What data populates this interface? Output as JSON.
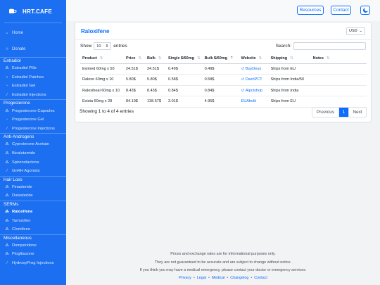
{
  "brand": {
    "title": "HRT.CAFE"
  },
  "sidebar": {
    "top": [
      {
        "label": "Home",
        "icon": "home-icon"
      },
      {
        "label": "Donate",
        "icon": "donate-icon"
      }
    ],
    "sections": [
      {
        "title": "Estradiol",
        "items": [
          "Estradiol Pills",
          "Estradiol Patches",
          "Estradiol Gel",
          "Estradiol Injections"
        ]
      },
      {
        "title": "Progesterone",
        "items": [
          "Progesterone Capsules",
          "Progesterone Gel",
          "Progesterone Injections"
        ]
      },
      {
        "title": "Anti-Androgens",
        "items": [
          "Cyproterone Acetate",
          "Bicalutamide",
          "Spironolactone",
          "GnRH Agonists"
        ]
      },
      {
        "title": "Hair Loss",
        "items": [
          "Finasteride",
          "Dutasteride"
        ]
      },
      {
        "title": "SERMs",
        "items": [
          "Raloxifene",
          "Tamoxifen",
          "Clomifene"
        ]
      },
      {
        "title": "Miscellaneous",
        "items": [
          "Domperidone",
          "Pioglitazone",
          "HydroxyProg Injections"
        ]
      }
    ],
    "active": "Raloxifene"
  },
  "header": {
    "resources": "Resources",
    "contact": "Contact"
  },
  "card": {
    "title": "Raloxifene",
    "currency": "USD",
    "show_label": "Show",
    "entries_label": "entries",
    "page_length": "10",
    "search_label": "Search:",
    "search_value": "",
    "columns": [
      "Product",
      "Price",
      "Bulk",
      "Single $/60mg",
      "Bulk $/60mg",
      "Website",
      "Shipping",
      "Notes"
    ],
    "rows": [
      [
        "Evimed 60mg x 50",
        "24.51$",
        "24.51$",
        "0.49$",
        "0.49$",
        "BuyDeus",
        "Ships from EU",
        ""
      ],
      [
        "Raloxo 60mg x 10",
        "5.80$",
        "5.80$",
        "0.58$",
        "0.58$",
        "DashPCT",
        "Ships from India/50",
        ""
      ],
      [
        "Raloxiheal 60mg x 10",
        "8.43$",
        "8.43$",
        "0.84$",
        "0.84$",
        "Aipctshop",
        "Ships from India",
        ""
      ],
      [
        "Evista 60mg x 28",
        "84.19$",
        "138.57$",
        "3.01$",
        "4.95$",
        "EUAbolit",
        "Ships from EU",
        ""
      ]
    ],
    "info": "Showing 1 to 4 of 4 entries",
    "pager": {
      "prev": "Previous",
      "current": "1",
      "next": "Next"
    }
  },
  "footer": {
    "line1": "Prices and exchange rates are for informational purposes only.",
    "line2": "They are not guaranteed to be accurate and are subject to change without notice.",
    "line3": "If you think you may have a medical emergency, please contact your doctor or emergency services.",
    "links": [
      "Privacy",
      "Legal",
      "Medical",
      "Changelog",
      "Contact"
    ]
  }
}
